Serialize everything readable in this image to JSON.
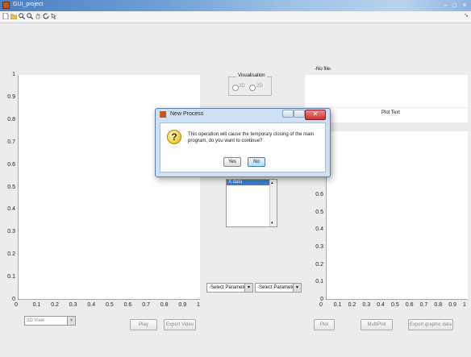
{
  "window": {
    "title": "GUI_project"
  },
  "toolbar": {
    "icons": [
      "new-file-icon",
      "open-folder-icon",
      "zoom-in-icon",
      "zoom-out-icon",
      "pan-icon",
      "rotate-icon",
      "data-cursor-icon"
    ]
  },
  "left_axes": {
    "y_ticks": [
      "1",
      "0.9",
      "0.8",
      "0.7",
      "0.6",
      "0.5",
      "0.4",
      "0.3",
      "0.2",
      "0.1",
      "0"
    ],
    "x_ticks": [
      "0",
      "0.1",
      "0.2",
      "0.3",
      "0.4",
      "0.5",
      "0.6",
      "0.7",
      "0.8",
      "0.9",
      "1"
    ]
  },
  "view_select": {
    "value": "3D View"
  },
  "buttons": {
    "play": "Play",
    "export_video": "Export Video",
    "plot": "Plot",
    "multiplot": "MultiPlot",
    "export_graphic": "Export graphic data"
  },
  "visualisation": {
    "title": "Visualisation",
    "opt_3d": "3D",
    "opt_2d": "2D"
  },
  "no_file": "-No file-",
  "plot_text": "Plot Text",
  "listbox": {
    "selected": "X data"
  },
  "param_select_1": {
    "value": "-Select Parameters-"
  },
  "param_select_2": {
    "value": "-Select Parameters-"
  },
  "right_axes": {
    "y_ticks": [
      "0.6",
      "0.5",
      "0.4",
      "0.3",
      "0.2",
      "0.1",
      "0"
    ],
    "x_ticks": [
      "0",
      "0.1",
      "0.2",
      "0.3",
      "0.4",
      "0.5",
      "0.6",
      "0.7",
      "0.8",
      "0.9",
      "1"
    ]
  },
  "dialog": {
    "title": "New Process",
    "message": "This operation will cause the temporary closing of the main program, do you want to continue?",
    "yes": "Yes",
    "no": "No",
    "close_glyph": "✕"
  }
}
